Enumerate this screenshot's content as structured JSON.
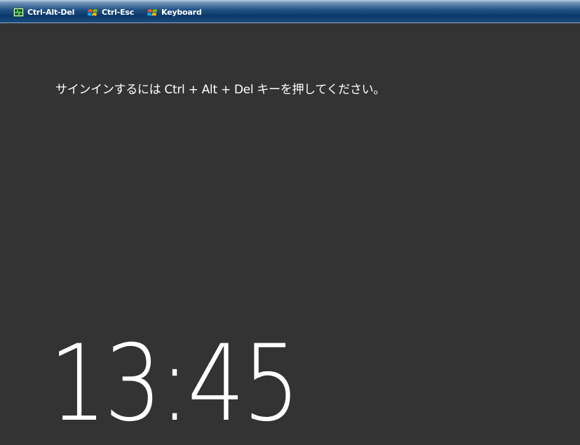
{
  "toolbar": {
    "buttons": [
      {
        "label": "Ctrl-Alt-Del",
        "icon": "monitor-pulse-icon"
      },
      {
        "label": "Ctrl-Esc",
        "icon": "windows-logo-icon"
      },
      {
        "label": "Keyboard",
        "icon": "windows-logo-icon"
      }
    ]
  },
  "lock_screen": {
    "prompt": "サインインするには Ctrl + Alt + Del キーを押してください。",
    "time": "13:45"
  },
  "colors": {
    "background": "#333333",
    "toolbar": "#0b3868",
    "text": "#ffffff"
  }
}
